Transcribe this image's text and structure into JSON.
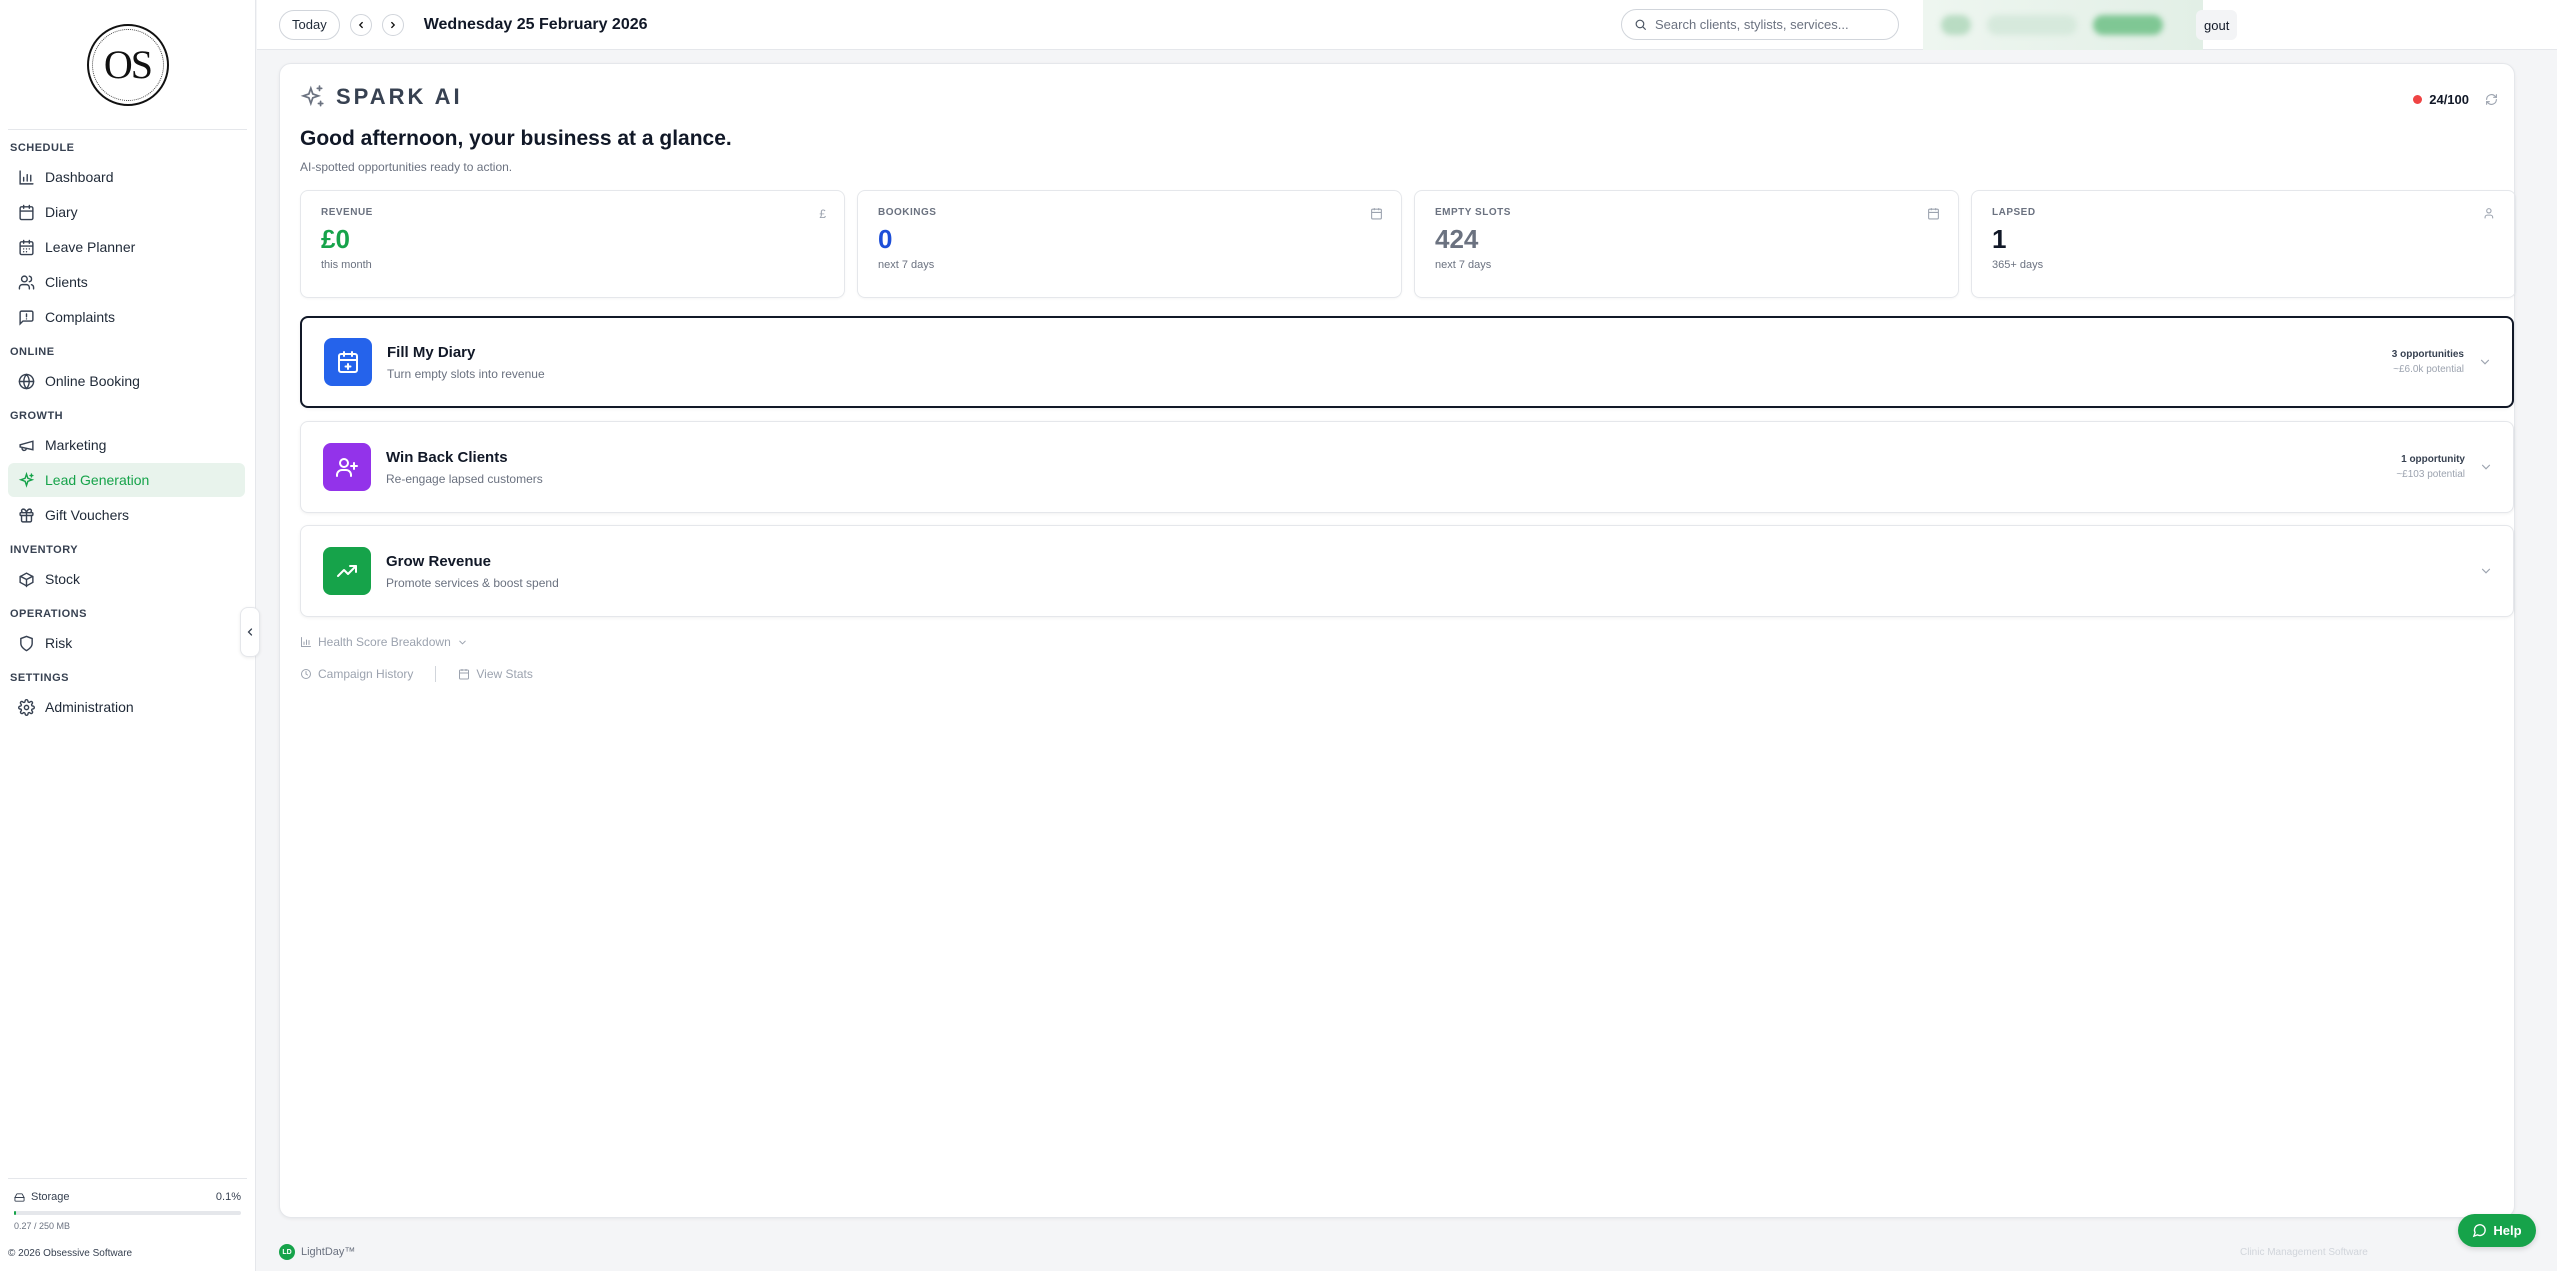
{
  "brand": {
    "logo_text": "OS"
  },
  "sidebar": {
    "sections": {
      "schedule": "SCHEDULE",
      "online": "ONLINE",
      "growth": "GROWTH",
      "inventory": "INVENTORY",
      "operations": "OPERATIONS",
      "settings": "SETTINGS"
    },
    "items": {
      "dashboard": "Dashboard",
      "diary": "Diary",
      "leave_planner": "Leave Planner",
      "clients": "Clients",
      "complaints": "Complaints",
      "online_booking": "Online Booking",
      "marketing": "Marketing",
      "lead_generation": "Lead Generation",
      "gift_vouchers": "Gift Vouchers",
      "stock": "Stock",
      "risk": "Risk",
      "administration": "Administration"
    },
    "active_item": "lead_generation",
    "storage": {
      "label": "Storage",
      "percent": "0.1%",
      "usage": "0.27 / 250 MB",
      "fill_fraction": 0.001
    },
    "copyright": "© 2026 Obsessive Software"
  },
  "topbar": {
    "today_label": "Today",
    "date": "Wednesday 25 February 2026",
    "search_placeholder": "Search clients, stylists, services...",
    "logout_label": "gout"
  },
  "spark": {
    "title": "SPARK AI",
    "health_score": "24/100",
    "greeting": "Good afternoon, your business at a glance.",
    "subtitle": "AI-spotted opportunities ready to action."
  },
  "stats": [
    {
      "label": "REVENUE",
      "value": "£0",
      "sub": "this month",
      "color": "#16a34a",
      "icon": "pound-icon"
    },
    {
      "label": "BOOKINGS",
      "value": "0",
      "sub": "next 7 days",
      "color": "#1d4ed8",
      "icon": "calendar-icon"
    },
    {
      "label": "EMPTY SLOTS",
      "value": "424",
      "sub": "next 7 days",
      "color": "#6b7280",
      "icon": "calendar-icon"
    },
    {
      "label": "LAPSED",
      "value": "1",
      "sub": "365+ days",
      "color": "#111827",
      "icon": "users-icon"
    }
  ],
  "actions": [
    {
      "title": "Fill My Diary",
      "desc": "Turn empty slots into revenue",
      "count": "3 opportunities",
      "potential": "~£6.0k potential",
      "color": "#2563eb",
      "icon": "calendar-plus-icon"
    },
    {
      "title": "Win Back Clients",
      "desc": "Re-engage lapsed customers",
      "count": "1 opportunity",
      "potential": "~£103 potential",
      "color": "#9333ea",
      "icon": "user-plus-icon"
    },
    {
      "title": "Grow Revenue",
      "desc": "Promote services & boost spend",
      "count": "",
      "potential": "",
      "color": "#16a34a",
      "icon": "trending-up-icon"
    }
  ],
  "links": {
    "health_breakdown": "Health Score Breakdown",
    "campaign_history": "Campaign History",
    "view_stats": "View Stats"
  },
  "footer": {
    "badge": "LD",
    "brand": "LightDay™",
    "right": "Clinic Management Software",
    "help_label": "Help"
  }
}
